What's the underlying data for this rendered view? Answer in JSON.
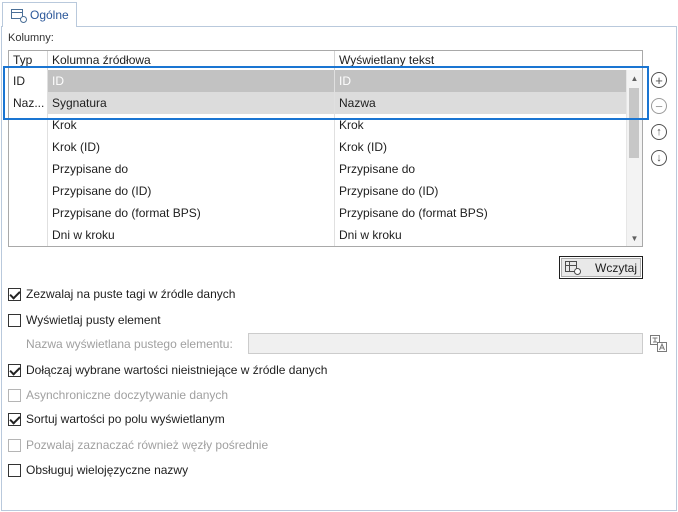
{
  "tab": {
    "label": "Ogólne",
    "icon": "window-settings-icon"
  },
  "columns_label": "Kolumny:",
  "grid": {
    "headers": [
      "Typ",
      "Kolumna źródłowa",
      "Wyświetlany tekst"
    ],
    "rows": [
      {
        "type": "ID",
        "source": "ID",
        "display": "ID"
      },
      {
        "type": "Naz...",
        "source": "Sygnatura",
        "display": "Nazwa"
      },
      {
        "type": "",
        "source": "Krok",
        "display": "Krok"
      },
      {
        "type": "",
        "source": "Krok (ID)",
        "display": "Krok (ID)"
      },
      {
        "type": "",
        "source": "Przypisane do",
        "display": "Przypisane do"
      },
      {
        "type": "",
        "source": "Przypisane do (ID)",
        "display": "Przypisane do (ID)"
      },
      {
        "type": "",
        "source": "Przypisane do (format BPS)",
        "display": "Przypisane do (format BPS)"
      },
      {
        "type": "",
        "source": "Dni w kroku",
        "display": "Dni w kroku"
      }
    ]
  },
  "side_buttons": {
    "add": "+",
    "remove": "−",
    "up": "↑",
    "down": "↓"
  },
  "load_button": {
    "label": "Wczytaj",
    "icon": "grid-search-icon"
  },
  "checkboxes": {
    "allow_empty_tags": {
      "label": "Zezwalaj na puste tagi w źródle danych",
      "checked": true,
      "enabled": true
    },
    "show_empty_element": {
      "label": "Wyświetlaj pusty element",
      "checked": false,
      "enabled": true
    },
    "attach_nonexistent": {
      "label": "Dołączaj wybrane wartości nieistniejące w źródle danych",
      "checked": true,
      "enabled": true
    },
    "async_loading": {
      "label": "Asynchroniczne doczytywanie danych",
      "checked": false,
      "enabled": false
    },
    "sort_by_display": {
      "label": "Sortuj wartości po polu wyświetlanym",
      "checked": true,
      "enabled": true
    },
    "select_intermediate": {
      "label": "Pozwalaj zaznaczać również węzły pośrednie",
      "checked": false,
      "enabled": false
    },
    "multilingual": {
      "label": "Obsługuj wielojęzyczne nazwy",
      "checked": false,
      "enabled": true
    }
  },
  "empty_element": {
    "label": "Nazwa wyświetlana pustego elementu:",
    "value": "",
    "icon": "translate-icon"
  },
  "colors": {
    "accent": "#1a75d2",
    "selected_row": "#c2c2c2",
    "tab_text": "#2b579a"
  }
}
